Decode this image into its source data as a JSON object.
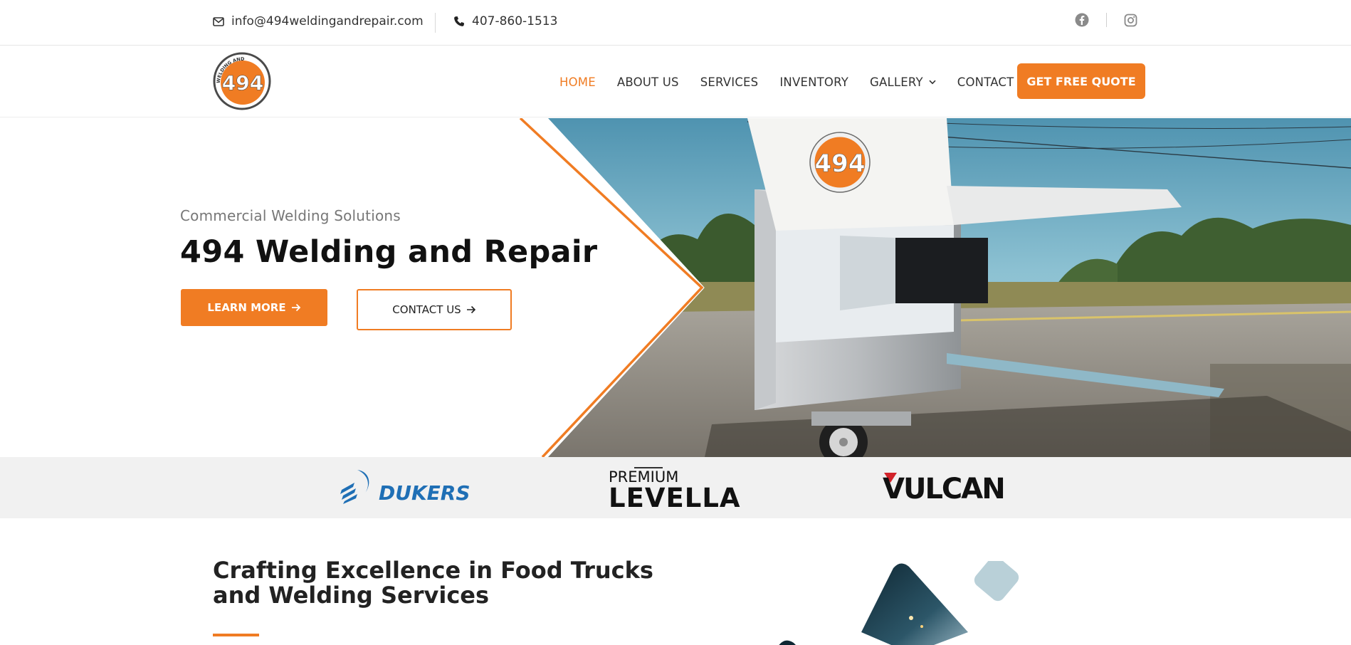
{
  "topbar": {
    "email": "info@494weldingandrepair.com",
    "phone": "407-860-1513",
    "icons": [
      "mail-icon",
      "phone-icon",
      "facebook-icon",
      "instagram-icon"
    ]
  },
  "header": {
    "logo": {
      "number": "494",
      "ring_text": "WELDING AND REPAIR"
    },
    "nav": [
      {
        "label": "HOME",
        "active": true
      },
      {
        "label": "ABOUT US"
      },
      {
        "label": "SERVICES"
      },
      {
        "label": "INVENTORY"
      },
      {
        "label": "GALLERY",
        "has_dropdown": true
      },
      {
        "label": "CONTACT"
      }
    ],
    "cta_label": "GET FREE QUOTE"
  },
  "hero": {
    "subtitle": "Commercial Welding Solutions",
    "title": "494 Welding and Repair",
    "learn_more_label": "LEARN MORE",
    "contact_label": "CONTACT US"
  },
  "brands": {
    "dukers": "DUKERS",
    "levella_top": "PREMIUM",
    "levella": "LEVELLA",
    "vulcan": "VULCAN"
  },
  "about": {
    "title": "Crafting Excellence in Food Trucks and Welding Services"
  },
  "colors": {
    "accent": "#f07c23",
    "text_dark": "#1f1f1f",
    "brand_strip": "#f1f1f1",
    "dukers_blue": "#1f6fb5"
  }
}
